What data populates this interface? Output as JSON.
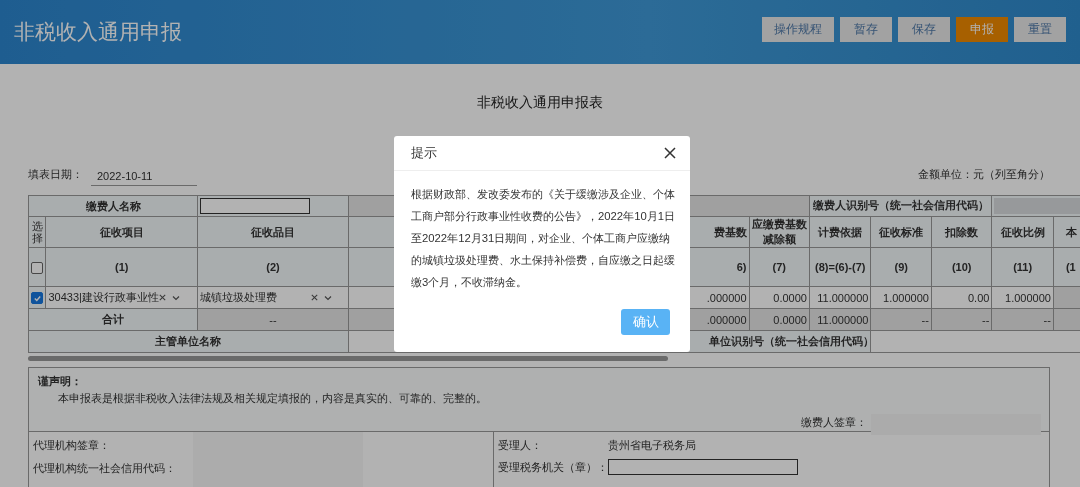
{
  "header": {
    "title": "非税收入通用申报",
    "buttons": [
      {
        "label": "操作规程",
        "primary": false
      },
      {
        "label": "暂存",
        "primary": false
      },
      {
        "label": "保存",
        "primary": false
      },
      {
        "label": "申报",
        "primary": true
      },
      {
        "label": "重置",
        "primary": false
      }
    ]
  },
  "form": {
    "title": "非税收入通用申报表",
    "fill_date_label": "填表日期：",
    "fill_date": "2022-10-11",
    "amount_unit": "金额单位：元（列至角分）"
  },
  "table": {
    "payer_name_label": "缴费人名称",
    "payer_id_label": "缴费人识别号（统一社会信用代码）",
    "select_label": "选择",
    "select_all_checked": false,
    "columns": [
      {
        "label": "征收项目",
        "number": "(1)"
      },
      {
        "label": "征收品目",
        "number": "(2)"
      },
      {
        "label": "费基数",
        "number": "6)"
      },
      {
        "label": "应缴费基数减除额",
        "number": "(7)"
      },
      {
        "label": "计费依据",
        "number": "(8)=(6)-(7)"
      },
      {
        "label": "征收标准",
        "number": "(9)"
      },
      {
        "label": "扣除数",
        "number": "(10)"
      },
      {
        "label": "征收比例",
        "number": "(11)"
      },
      {
        "label": "本",
        "number": "(1"
      }
    ],
    "rows": [
      {
        "checked": true,
        "item": "30433|建设行政事业性",
        "category": "城镇垃圾处理费",
        "values": [
          ".000000",
          "0.0000",
          "11.000000",
          "1.000000",
          "0.00",
          "1.000000"
        ]
      }
    ],
    "total_row": {
      "label": "合计",
      "category": "--",
      "values": [
        ".000000",
        "0.0000",
        "11.000000",
        "--",
        "--",
        "--"
      ]
    },
    "authority_row": {
      "name_label": "主管单位名称",
      "id_label": "单位识别号（统一社会信用代码）"
    }
  },
  "declaration": {
    "title": "谨声明：",
    "text": "本申报表是根据非税收入法律法规及相关规定填报的，内容是真实的、可靠的、完整的。",
    "signature_label": "缴费人签章："
  },
  "footer": {
    "agent_seal_label": "代理机构签章：",
    "agent_code_label": "代理机构统一社会信用代码：",
    "receiver_label": "受理人：",
    "receiver_value": "贵州省电子税务局",
    "tax_office_label": "受理税务机关（章）："
  },
  "dialog": {
    "title": "提示",
    "message": "根据财政部、发改委发布的《关于缓缴涉及企业、个体工商户部分行政事业性收费的公告》，2022年10月1日至2022年12月31日期间，对企业、个体工商户应缴纳的城镇垃圾处理费、水土保持补偿费，自应缴之日起缓缴3个月，不收滞纳金。",
    "confirm": "确认"
  }
}
